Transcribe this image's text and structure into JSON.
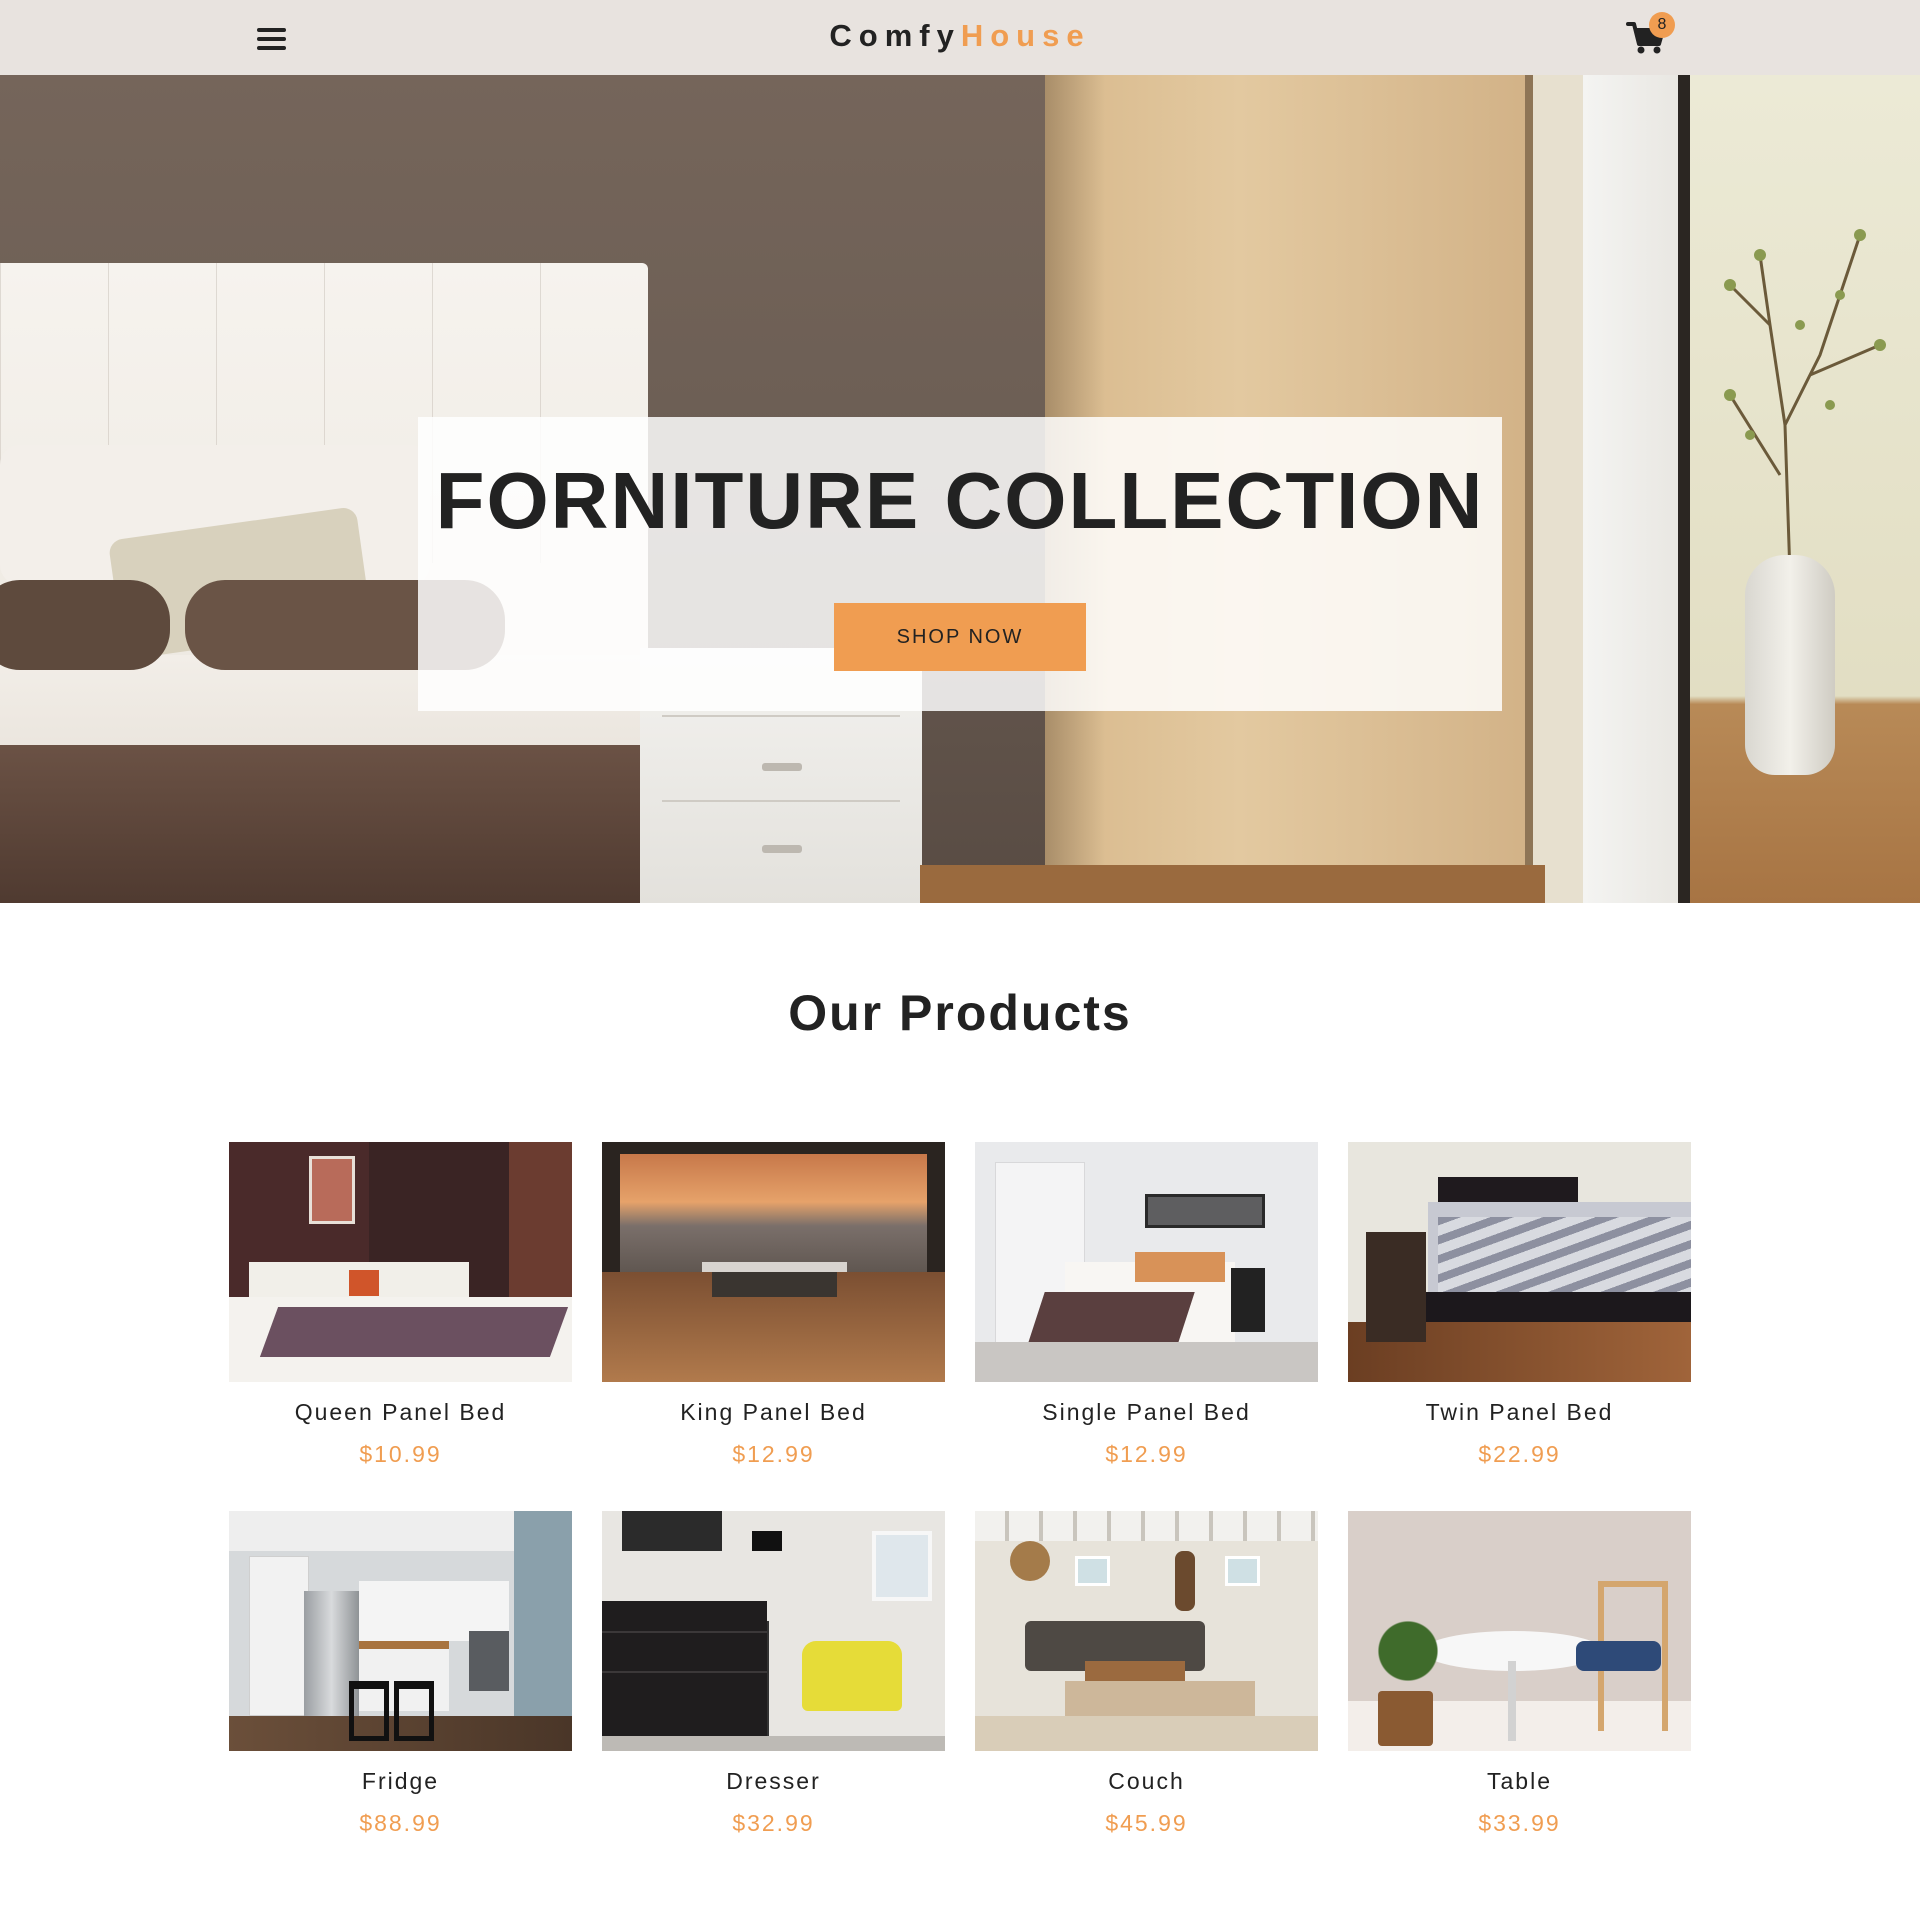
{
  "navbar": {
    "logo_part1": "Comfy",
    "logo_part2": "House",
    "cart_count": "8",
    "icons": [
      "menu-icon",
      "cart-icon"
    ]
  },
  "hero": {
    "title": "FORNITURE COLLECTION",
    "button_label": "SHOP NOW"
  },
  "products": {
    "title": "Our Products",
    "items": [
      {
        "name": "Queen Panel Bed",
        "price": "$10.99"
      },
      {
        "name": "King Panel Bed",
        "price": "$12.99"
      },
      {
        "name": "Single Panel Bed",
        "price": "$12.99"
      },
      {
        "name": "Twin Panel Bed",
        "price": "$22.99"
      },
      {
        "name": "Fridge",
        "price": "$88.99"
      },
      {
        "name": "Dresser",
        "price": "$32.99"
      },
      {
        "name": "Couch",
        "price": "$45.99"
      },
      {
        "name": "Table",
        "price": "$33.99"
      }
    ]
  },
  "colors": {
    "accent": "#f09d51",
    "navbar_bg": "#e8e3df",
    "text": "#222222"
  }
}
